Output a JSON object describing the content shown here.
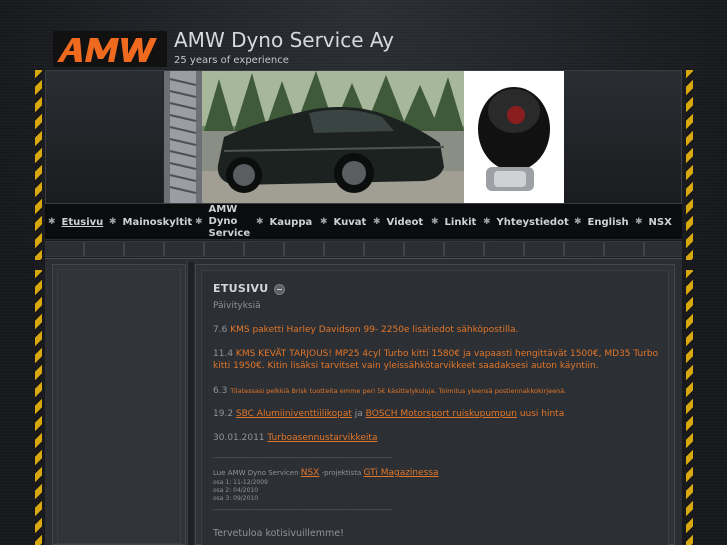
{
  "header": {
    "title": "AMW Dyno Service Ay",
    "tagline": "25 years of experience"
  },
  "nav": {
    "items": [
      {
        "label": "Etusivu",
        "active": true
      },
      {
        "label": "Mainoskyltit"
      },
      {
        "label": "AMW Dyno Service"
      },
      {
        "label": "Kauppa"
      },
      {
        "label": "Kuvat"
      },
      {
        "label": "Videot"
      },
      {
        "label": "Linkit"
      },
      {
        "label": "Yhteystiedot"
      },
      {
        "label": "English"
      },
      {
        "label": "NSX"
      }
    ]
  },
  "main": {
    "title": "ETUSIVU",
    "subtitle": "Päivityksiä",
    "news": [
      {
        "date": "7.6",
        "text": "KMS paketti Harley Davidson 99-  2250e lisätiedot sähköpostilla."
      },
      {
        "date": "11.4",
        "text": "KMS KEVÄT TARJOUS! MP25 4cyl Turbo kitti 1580€ ja vapaasti hengittävät 1500€, MD35 Turbo kitti 1950€. Kitin lisäksi tarvitset vain yleissähkötarvikkeet saadaksesi auton käyntiin."
      },
      {
        "date": "6.3",
        "text": "Tilatessasi pelkkiä Brisk tuotteita emme peri 5€ käsittelykuluja. Toimitus yleensä postiennakkokirjeenä."
      },
      {
        "date": "19.2",
        "link1": "SBC Alumiiniventtiilikopat",
        "mid": " ja ",
        "link2": "BOSCH Motorsport ruiskupumpun",
        "tail": " uusi hinta"
      },
      {
        "date": "30.01.2011",
        "link1": "Turboasennustarvikkeita"
      }
    ],
    "separator": "-----------------------------------------------------------------------",
    "project": {
      "prefix": "Lue AMW Dyno Servicen ",
      "link1": "NSX",
      "mid": " -projektista ",
      "link2": "GTi Magazinessa",
      "parts": [
        "osa 1: 11-12/2009",
        "osa 2: 04/2010",
        "osa 3: 09/2010"
      ]
    },
    "welcome": "Tervetuloa kotisivuillemme!"
  },
  "colors": {
    "accent": "#e1762a",
    "hazard": "#d8a80e",
    "background": "#1d2024"
  }
}
